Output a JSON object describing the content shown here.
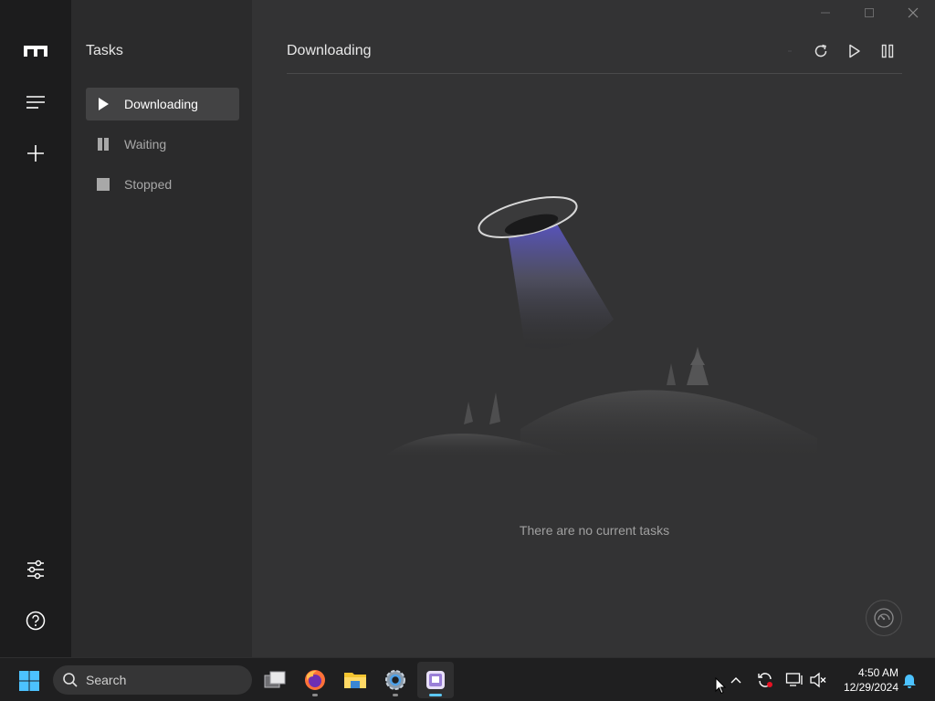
{
  "sidebar": {
    "title": "Tasks",
    "items": [
      {
        "label": "Downloading",
        "icon": "play-icon",
        "active": true
      },
      {
        "label": "Waiting",
        "icon": "pause-icon",
        "active": false
      },
      {
        "label": "Stopped",
        "icon": "stop-icon",
        "active": false
      }
    ]
  },
  "main": {
    "title": "Downloading",
    "empty_message": "There are no current tasks",
    "toolbar": [
      "delete-icon",
      "refresh-icon",
      "resume-all-icon",
      "pause-all-icon"
    ]
  },
  "rail": {
    "icons": [
      "logo-icon",
      "menu-icon",
      "add-icon",
      "preferences-icon",
      "help-icon"
    ]
  },
  "taskbar": {
    "search_label": "Search",
    "apps": [
      "task-view-icon",
      "firefox-icon",
      "file-explorer-icon",
      "settings-icon",
      "motrix-icon"
    ],
    "active_app": "motrix-icon",
    "tray_icons": [
      "chevron-up-icon",
      "sync-icon",
      "network-icon",
      "volume-muted-icon",
      "notification-bell-icon"
    ],
    "time": "4:50 AM",
    "date": "12/29/2024"
  },
  "colors": {
    "rail_bg": "#1c1c1d",
    "sidebar_bg": "#2b2b2c",
    "main_bg": "#333334",
    "active_item_bg": "#434344",
    "taskbar_bg": "#1f1f20",
    "taskbar_accent": "#5cc8f5"
  }
}
